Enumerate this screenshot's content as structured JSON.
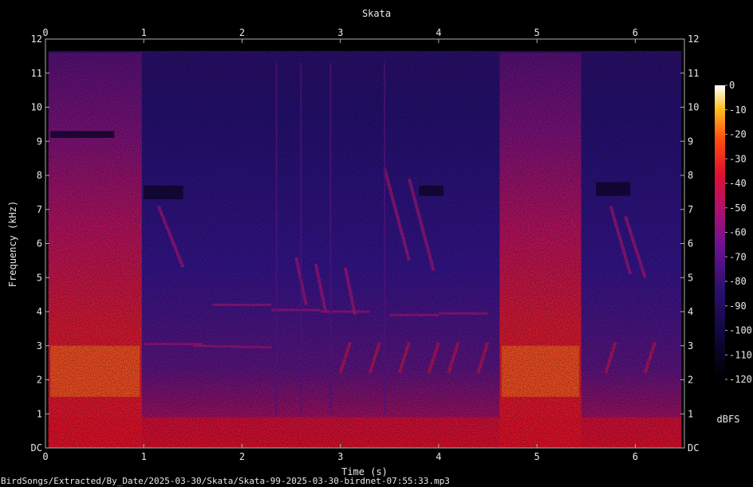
{
  "chart_data": {
    "type": "heatmap",
    "title": "Skata",
    "xlabel": "Time (s)",
    "ylabel": "Frequency (kHz)",
    "x_ticks": [
      "0",
      "1",
      "2",
      "3",
      "4",
      "5",
      "6"
    ],
    "y_ticks": [
      "DC",
      "1",
      "2",
      "3",
      "4",
      "5",
      "6",
      "7",
      "8",
      "9",
      "10",
      "11",
      "12"
    ],
    "xlim": [
      0,
      6.5
    ],
    "ylim": [
      0,
      12
    ],
    "colorbar": {
      "label": "dBFS",
      "ticks": [
        "0",
        "-10",
        "-20",
        "-30",
        "-40",
        "-50",
        "-60",
        "-70",
        "-80",
        "-90",
        "-100",
        "-110",
        "-120"
      ],
      "range": [
        -120,
        0
      ]
    },
    "footer": "BirdSongs/Extracted/By_Date/2025-03-30/Skata/Skata-99-2025-03-30-birdnet-07:55:33.mp3",
    "colors": {
      "background": "#000000",
      "text": "#e8e8e8",
      "low": "#1a0b4a",
      "mid": "#c8102e",
      "high": "#ffff80"
    }
  }
}
